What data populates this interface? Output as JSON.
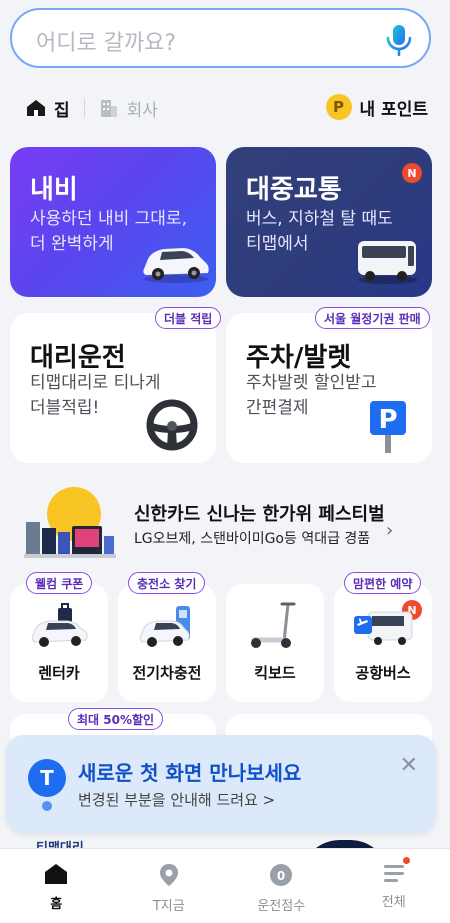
{
  "search": {
    "placeholder": "어디로 갈까요?",
    "mic_icon": "mic-icon"
  },
  "places": [
    {
      "label": "집",
      "icon": "home-icon"
    },
    {
      "label": "회사",
      "icon": "building-icon"
    }
  ],
  "points": {
    "coin": "P",
    "label": "내 포인트"
  },
  "cards": {
    "navi": {
      "title": "내비",
      "desc": "사용하던 내비 그대로,\n더 완벽하게"
    },
    "transit": {
      "title": "대중교통",
      "desc": "버스, 지하철 탈 때도\n티맵에서",
      "badge": "N"
    },
    "driver": {
      "title": "대리운전",
      "desc": "티맵대리로 티나게\n더블적립!",
      "tag": "더블 적립"
    },
    "parking": {
      "title": "주차/발렛",
      "desc": "주차발렛 할인받고\n간편결제",
      "tag": "서울 월정기권 판매"
    }
  },
  "banner": {
    "title": "신한카드 신나는 한가위 페스티벌",
    "subtitle": "LG오브제, 스탠바이미Go등 역대급 경품"
  },
  "tiles": [
    {
      "label": "렌터카",
      "tag": "웰컴 쿠폰"
    },
    {
      "label": "전기차충전",
      "tag": "충전소 찾기"
    },
    {
      "label": "킥보드"
    },
    {
      "label": "공항버스",
      "tag": "맘편한 예약",
      "badge": "N"
    }
  ],
  "lower": {
    "tag": "최대 50%할인",
    "peek_text": "티맵대리"
  },
  "toast": {
    "logo": "T",
    "title": "새로운 첫 화면 만나보세요",
    "subtitle": "변경된 부분을 안내해 드려요 >",
    "close": "✕"
  },
  "nav": [
    {
      "label": "홈",
      "icon": "home-icon",
      "active": true
    },
    {
      "label": "T지금",
      "icon": "location-pin-icon"
    },
    {
      "label": "운전점수",
      "icon": "score-gauge-icon",
      "value": "0"
    },
    {
      "label": "전체",
      "icon": "menu-icon"
    }
  ],
  "colors": {
    "accent_blue": "#1E6CF0",
    "navi_gradient_start": "#7A3CF5",
    "transit_bg": "#2D3C7C",
    "tag_purple": "#8A4DE6",
    "badge_red": "#F04A2E",
    "coin_yellow": "#F8C524"
  }
}
